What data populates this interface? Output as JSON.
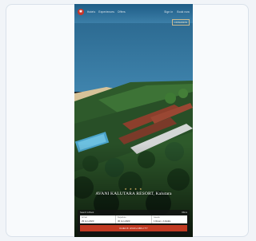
{
  "nav": {
    "logo_glyph": "✱",
    "links": [
      "Hotels",
      "Experiences",
      "Offers"
    ],
    "right_links": [
      "Sign in",
      "Book now"
    ],
    "badge": "CINNAMON"
  },
  "hero": {
    "stars": "★ ★ ★ ★",
    "title": "AVANI KALUTARA RESORT, Kalutara"
  },
  "booking": {
    "heading": "Search & Book",
    "heading_right": "Offers",
    "fields": [
      {
        "label": "Arrival",
        "value": "29 Jun 2023"
      },
      {
        "label": "Departure",
        "value": "30 Jun 2023"
      },
      {
        "label": "Guests",
        "value": "1 Room, 2 Adults"
      }
    ],
    "cta_label": "CHECK AVAILABILITY"
  },
  "colors": {
    "sea": "#2f6f95",
    "beach": "#d8c49a",
    "foliage": "#2f5a2c",
    "accent": "#c23a22"
  }
}
